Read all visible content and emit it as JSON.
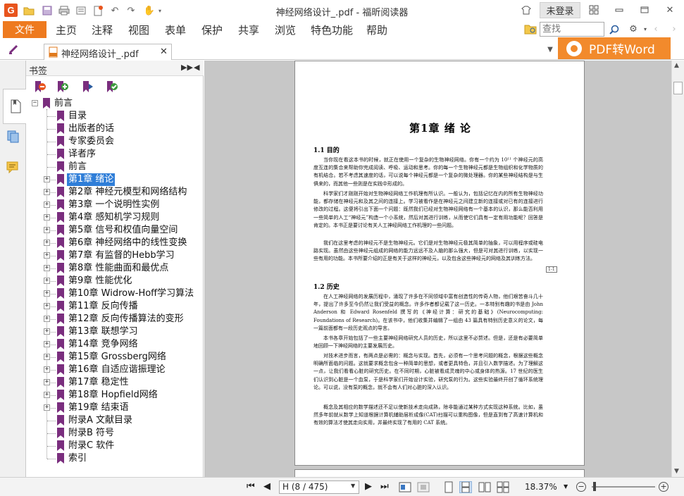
{
  "app": {
    "window_title": "神经网络设计_.pdf - 福昕阅读器",
    "login_label": "未登录"
  },
  "menu": {
    "file": "文件",
    "items": [
      "主页",
      "注释",
      "视图",
      "表单",
      "保护",
      "共享",
      "浏览",
      "特色功能",
      "帮助"
    ]
  },
  "search": {
    "placeholder": "查找",
    "value": ""
  },
  "tab": {
    "label": "神经网络设计_.pdf"
  },
  "promo": {
    "label": "PDF转Word"
  },
  "bookmarks": {
    "title": "书签",
    "root": "前言",
    "items": [
      {
        "label": "目录",
        "expandable": false
      },
      {
        "label": "出版者的话",
        "expandable": false
      },
      {
        "label": "专家委员会",
        "expandable": false
      },
      {
        "label": "译者序",
        "expandable": false
      },
      {
        "label": "前言",
        "expandable": false
      },
      {
        "label": "第1章  绪论",
        "expandable": true,
        "selected": true
      },
      {
        "label": "第2章  神经元模型和网络结构",
        "expandable": true
      },
      {
        "label": "第3章  一个说明性实例",
        "expandable": true
      },
      {
        "label": "第4章  感知机学习规则",
        "expandable": true
      },
      {
        "label": "第5章  信号和权值向量空间",
        "expandable": true
      },
      {
        "label": "第6章  神经网络中的线性变换",
        "expandable": true
      },
      {
        "label": "第7章  有监督的Hebb学习",
        "expandable": true
      },
      {
        "label": "第8章  性能曲面和最优点",
        "expandable": true
      },
      {
        "label": "第9章  性能优化",
        "expandable": true
      },
      {
        "label": "第10章   Widrow-Hoff学习算法",
        "expandable": true
      },
      {
        "label": "第11章   反向传播",
        "expandable": true
      },
      {
        "label": "第12章  反向传播算法的变形",
        "expandable": true
      },
      {
        "label": "第13章   联想学习",
        "expandable": true
      },
      {
        "label": "第14章  竞争网络",
        "expandable": true
      },
      {
        "label": "第15章  Grossberg网络",
        "expandable": true
      },
      {
        "label": "第16章  自适应谐振理论",
        "expandable": true
      },
      {
        "label": "第17章  稳定性",
        "expandable": true
      },
      {
        "label": "第18章  Hopfield网络",
        "expandable": true
      },
      {
        "label": "第19章  结束语",
        "expandable": true
      },
      {
        "label": "附录A  文献目录",
        "expandable": false
      },
      {
        "label": "附录B   符号",
        "expandable": false
      },
      {
        "label": "附录C   软件",
        "expandable": false
      },
      {
        "label": "索引",
        "expandable": false
      }
    ]
  },
  "page": {
    "chapter_title": "第1章   绪      论",
    "sec1_heading": "1.1   目的",
    "sec1_p1": "当你现在看这本书的时候，就正在使用一个复杂的生物神经网络。你有一个约为 10¹¹ 个神经元的高度互连的集合来帮助你完成阅读、呼吸、运动和思考。你的每一个生物神经元都是生物组织和化学物质的有机结合。若不考虑其速度的话，可以说每个神经元都是一个复杂的微处理器。你的某些神经结构是与生俱来的，而其他一些则是在实践中形成的。",
    "sec1_p2": "科学家们才刚刚开始对生物神经网络工作机理有所认识。一般认为，包括记忆在内的所有生物神经功能，都存储在神经元和及其之间的连接上。学习被看作是在神经元之间建立新的连接或对已有的连接进行修改的过程。这便将引出下面一个问题：既然我们已经对生物神经网络有一个基本的认识，那么能否利用一些简单的人工“神经元”构造一个小系统，然后对其进行训练，从而使它们具有一定有用功能呢？回答是肯定的。本书正是要讨论有关人工神经网络工作机理的一些问题。",
    "sec1_p3": "我们在这里考虑的神经元不是生物神经元。它们是对生物神经元极其简单的抽象，可以用程序或硅电路实现。虽然由这些神经元组成的网络的能力远远不及人脑的那么强大，但是可对其进行训练，以实现一些有用的功能。本书所要介绍的正是有关于这样的神经元，以及包含这些神经元的网络及其训练方法。",
    "margin_mark": "1-1",
    "sec2_heading": "1.2   历史",
    "sec2_p1": "在人工神经网络的发展历程中，涌现了许多在不同领域中富有创造性的传奇人物，他们艰苦奋斗几十年，提出了许多至今仍然让我们受益的概念。许多作者都记载了这一历史。一本特别有趣的书是由 John Anderson 和 Edward Rosenfeld 撰写的《神经计算：研究的基础》(Neurocomputing: Foundations of Research)。在该书中，他们收集并编辑了一组由 43 篇具有特别历史意义的论文，每一篇前面都有一段历史观点的导言。",
    "sec2_p2": "本书各章开始包括了一些主要神经网络研究人员的历史，所以这里不必赘述。但是，还是有必要简单地回顾一下神经网络的主要发展历史。",
    "sec2_p3": "对技术进步而言，有两点是必需的：概念与实现。首先，必须有一个思考问题的概念，根据这些概念明确所面临的问题。这就要求概念包含一种简单的思想，或者更具特色，并且引入数学描述。为了理解这一点，让我们看看心脏的研究历史。在不同时期，心脏被看成灵魂的中心或身体的热源。17 世纪的医生们认识到心脏是一个血泵，于是科学家们开始设计实验，研究泵的行为。这些实验最终开创了循环系统理论。可以说，没有泵的概念，就不会有人们对心脏的深入认识。",
    "sec2_p4": "概念及其相应的数学描述还不足以使新技术走向成熟，除非能通过某种方式实现这种系统。比如，虽然多年前就从数学上知道根据计算机辅助层析成像(CAT)扫描可以重构图像，但是直到有了高速计算机和有效的算法才使其走向实用，并最终实现了有用的 CAT 系统。"
  },
  "status": {
    "page_indicator": "H (8 / 475)",
    "zoom": "18.37%"
  },
  "colors": {
    "accent_orange": "#ee7a1f",
    "promo_orange": "#f28a2c",
    "selection_blue": "#2f7ed8",
    "bookmark_purple": "#7a2e7e"
  }
}
